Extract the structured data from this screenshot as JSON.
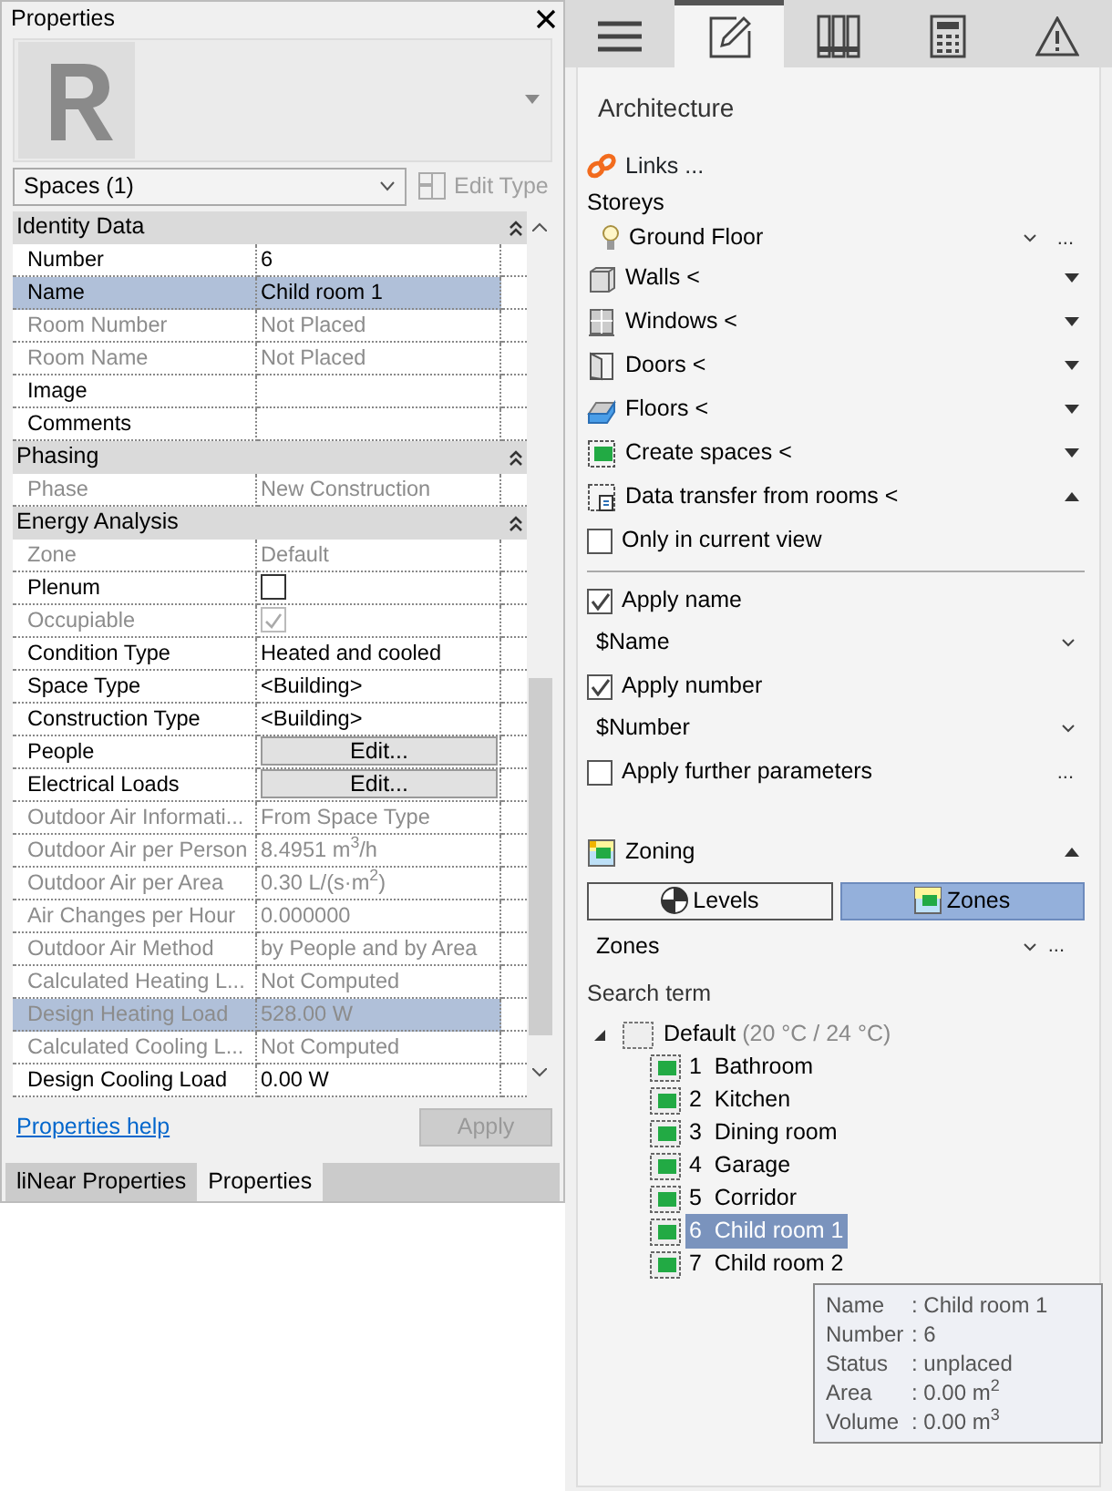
{
  "properties_panel": {
    "title": "Properties",
    "type_selector": {
      "value": "Spaces (1)"
    },
    "edit_type": {
      "label": "Edit Type",
      "disabled": true
    },
    "groups": [
      {
        "title": "Identity Data",
        "expanded": true,
        "rows": [
          {
            "kind": "text",
            "name": "Number",
            "value": "6",
            "disabled": false,
            "selected": false
          },
          {
            "kind": "text",
            "name": "Name",
            "value": "Child room 1",
            "disabled": false,
            "selected": true
          },
          {
            "kind": "text",
            "name": "Room Number",
            "value": "Not Placed",
            "disabled": true,
            "selected": false
          },
          {
            "kind": "text",
            "name": "Room Name",
            "value": "Not Placed",
            "disabled": true,
            "selected": false
          },
          {
            "kind": "text",
            "name": "Image",
            "disabled": false,
            "selected": false
          },
          {
            "kind": "text",
            "name": "Comments",
            "disabled": false,
            "selected": false
          }
        ]
      },
      {
        "title": "Phasing",
        "expanded": true,
        "rows": [
          {
            "kind": "text",
            "name": "Phase",
            "value": "New Construction",
            "disabled": true,
            "selected": false
          }
        ]
      },
      {
        "title": "Energy Analysis",
        "expanded": true,
        "rows": [
          {
            "kind": "text",
            "name": "Zone",
            "value": "Default",
            "disabled": true,
            "selected": false
          },
          {
            "kind": "checkbox",
            "name": "Plenum",
            "checked": false,
            "disabled": false,
            "selected": false
          },
          {
            "kind": "checkbox",
            "name": "Occupiable",
            "checked": true,
            "disabled": true,
            "selected": false
          },
          {
            "kind": "text",
            "name": "Condition Type",
            "value": "Heated and cooled",
            "disabled": false,
            "selected": false
          },
          {
            "kind": "text",
            "name": "Space Type",
            "value": "<Building>",
            "disabled": false,
            "selected": false
          },
          {
            "kind": "text",
            "name": "Construction Type",
            "value": "<Building>",
            "disabled": false,
            "selected": false
          },
          {
            "kind": "button",
            "name": "People",
            "value": "Edit...",
            "disabled": false,
            "selected": false
          },
          {
            "kind": "button",
            "name": "Electrical Loads",
            "value": "Edit...",
            "disabled": false,
            "selected": false
          },
          {
            "kind": "text",
            "name": "Outdoor Air Informati...",
            "value": "From Space Type",
            "disabled": true,
            "selected": false
          },
          {
            "kind": "text",
            "name": "Outdoor Air per Person",
            "value": "8.4951 m$^{3}$/h",
            "disabled": true,
            "selected": false
          },
          {
            "kind": "text",
            "name": "Outdoor Air per Area",
            "value": "0.30 L/(s·m$^{2}$)",
            "disabled": true,
            "selected": false
          },
          {
            "kind": "text",
            "name": "Air Changes per Hour",
            "value": "0.000000",
            "disabled": true,
            "selected": false
          },
          {
            "kind": "text",
            "name": "Outdoor Air Method",
            "value": "by People and by Area",
            "disabled": true,
            "selected": false
          },
          {
            "kind": "text",
            "name": "Calculated Heating L...",
            "value": "Not Computed",
            "disabled": true,
            "selected": false
          },
          {
            "kind": "text",
            "name": "Design Heating Load",
            "value": "528.00 W",
            "disabled": true,
            "selected": true
          },
          {
            "kind": "text",
            "name": "Calculated Cooling L...",
            "value": "Not Computed",
            "disabled": true,
            "selected": false
          },
          {
            "kind": "text",
            "name": "Design Cooling Load",
            "value": "0.00 W",
            "disabled": false,
            "selected": false
          }
        ]
      }
    ],
    "help_link": "Properties help",
    "apply_button": {
      "label": "Apply",
      "disabled": true
    },
    "bottom_tabs": [
      {
        "label": "liNear Properties",
        "selected": false
      },
      {
        "label": "Properties",
        "selected": true
      }
    ]
  },
  "tool_panel": {
    "toolbar_tabs": [
      {
        "kind": "menu",
        "selected": false
      },
      {
        "kind": "edit",
        "selected": true
      },
      {
        "kind": "library",
        "selected": false
      },
      {
        "kind": "calculator",
        "selected": false
      },
      {
        "kind": "warning",
        "selected": false
      }
    ],
    "section_title": "Architecture",
    "links": "Links ...",
    "storeys": {
      "label": "Storeys",
      "value": "Ground Floor",
      "more": "..."
    },
    "categories": [
      {
        "kind": "walls",
        "label": "Walls <",
        "expanded": false
      },
      {
        "kind": "windows",
        "label": "Windows <",
        "expanded": false
      },
      {
        "kind": "doors",
        "label": "Doors <",
        "expanded": false
      },
      {
        "kind": "floors",
        "label": "Floors <",
        "expanded": false
      },
      {
        "kind": "spaces",
        "label": "Create spaces <",
        "expanded": false
      },
      {
        "kind": "transfer",
        "label": "Data transfer from rooms <",
        "expanded": true
      }
    ],
    "only_current_view": {
      "label": "Only in current view",
      "checked": false
    },
    "transfer_options": [
      {
        "kind": "checkbox",
        "label": "Apply name",
        "checked": true
      },
      {
        "kind": "dropdown",
        "value": "$Name"
      },
      {
        "kind": "checkbox",
        "label": "Apply number",
        "checked": true
      },
      {
        "kind": "dropdown",
        "value": "$Number"
      },
      {
        "kind": "checkbox",
        "label": "Apply further parameters",
        "checked": false,
        "more": "..."
      }
    ],
    "zoning": {
      "label": "Zoning",
      "expanded": true,
      "modes": [
        {
          "kind": "levels",
          "label": "Levels",
          "selected": false
        },
        {
          "kind": "zones",
          "label": "Zones",
          "selected": true
        }
      ],
      "view": {
        "value": "Zones",
        "more": "..."
      },
      "search": {
        "placeholder": "Search term"
      },
      "tree": [
        {
          "label": "Default",
          "detail": "(20 °C / 24 °C)",
          "expanded": true,
          "children": [
            {
              "number": "1",
              "label": "Bathroom",
              "selected": false
            },
            {
              "number": "2",
              "label": "Kitchen",
              "selected": false
            },
            {
              "number": "3",
              "label": "Dining room",
              "selected": false
            },
            {
              "number": "4",
              "label": "Garage",
              "selected": false
            },
            {
              "number": "5",
              "label": "Corridor",
              "selected": false
            },
            {
              "number": "6",
              "label": "Child room 1",
              "selected": true
            },
            {
              "number": "7",
              "label": "Child room 2",
              "selected": false
            }
          ]
        }
      ],
      "tooltip": [
        {
          "key": "Name",
          "value": ": Child room 1"
        },
        {
          "key": "Number",
          "value": ": 6"
        },
        {
          "key": "Status",
          "value": ": unplaced"
        },
        {
          "key": "Area",
          "value": ": 0.00 m$^{2}$"
        },
        {
          "key": "Volume",
          "value": ": 0.00 m$^{3}$"
        }
      ]
    }
  }
}
